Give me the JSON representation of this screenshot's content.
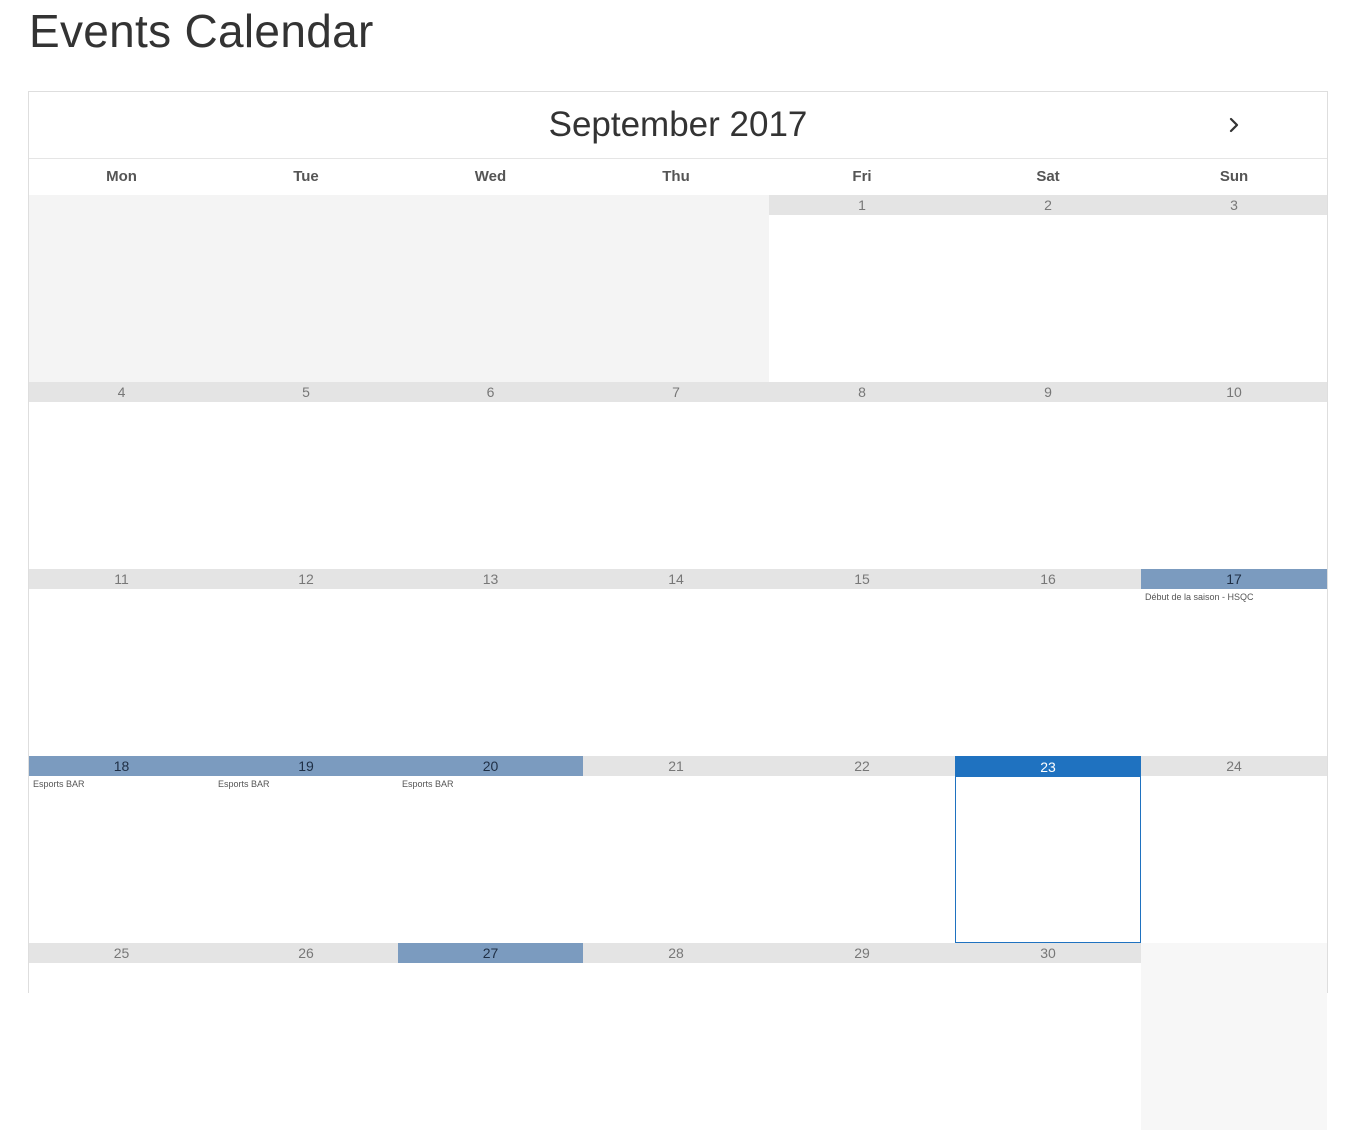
{
  "page": {
    "title": "Events Calendar"
  },
  "calendar": {
    "month_label": "September 2017",
    "next_icon": "chevron-right-icon",
    "weekdays": [
      "Mon",
      "Tue",
      "Wed",
      "Thu",
      "Fri",
      "Sat",
      "Sun"
    ],
    "leading_empty_days": 4,
    "days_in_month": 30,
    "today": 23,
    "visible_trailing_empty": 1,
    "events": {
      "17": [
        "Début de la saison - HSQC"
      ],
      "18": [
        "Esports BAR"
      ],
      "19": [
        "Esports BAR"
      ],
      "20": [
        "Esports BAR"
      ],
      "27": []
    },
    "highlighted_days": [
      17,
      18,
      19,
      20,
      27
    ],
    "colors": {
      "event_day": "#7b9bbf",
      "today": "#1f72c0",
      "day_header": "#e4e4e4",
      "empty_cell": "#f4f4f4"
    }
  }
}
